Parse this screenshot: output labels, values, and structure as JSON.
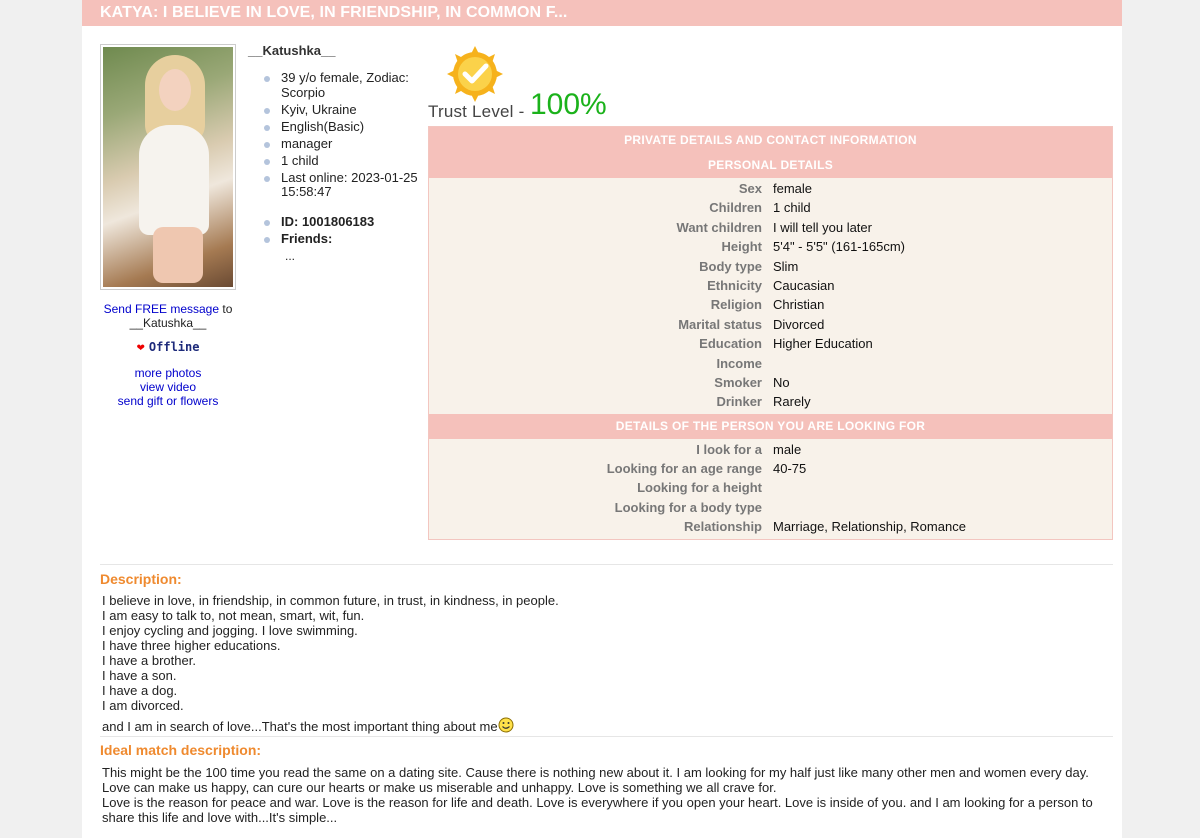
{
  "title": "KATYA: I BELIEVE IN LOVE, IN FRIENDSHIP, IN COMMON F...",
  "profile": {
    "username": "__Katushka__",
    "info": [
      "39 y/o female, Zodiac: Scorpio",
      "Kyiv, Ukraine",
      "English(Basic)",
      "manager",
      "1 child",
      "Last online: 2023-01-25 15:58:47"
    ],
    "id_label": "ID: 1001806183",
    "friends_label": "Friends:",
    "friends_more": "..."
  },
  "actions": {
    "send_free_message": "Send FREE message",
    "send_to": "to",
    "send_to_name": "__Katushka__",
    "status": "Offline",
    "more_photos": "more photos",
    "view_video": "view video",
    "send_gift": "send gift or flowers"
  },
  "trust": {
    "label": "Trust Level -",
    "value": "100%"
  },
  "details": {
    "header_private": "PRIVATE DETAILS AND CONTACT INFORMATION",
    "header_personal": "PERSONAL DETAILS",
    "personal": [
      {
        "key": "Sex",
        "value": "female"
      },
      {
        "key": "Children",
        "value": "1 child"
      },
      {
        "key": "Want children",
        "value": "I will tell you later"
      },
      {
        "key": "Height",
        "value": "5'4\" - 5'5\" (161-165cm)"
      },
      {
        "key": "Body type",
        "value": "Slim"
      },
      {
        "key": "Ethnicity",
        "value": "Caucasian"
      },
      {
        "key": "Religion",
        "value": "Christian"
      },
      {
        "key": "Marital status",
        "value": "Divorced"
      },
      {
        "key": "Education",
        "value": "Higher Education"
      },
      {
        "key": "Income",
        "value": ""
      },
      {
        "key": "Smoker",
        "value": "No"
      },
      {
        "key": "Drinker",
        "value": "Rarely"
      }
    ],
    "header_looking": "DETAILS OF THE PERSON YOU ARE LOOKING FOR",
    "looking": [
      {
        "key": "I look for a",
        "value": "male"
      },
      {
        "key": "Looking for an age range",
        "value": "40-75"
      },
      {
        "key": "Looking for a height",
        "value": ""
      },
      {
        "key": "Looking for a body type",
        "value": ""
      },
      {
        "key": "Relationship",
        "value": "Marriage, Relationship, Romance"
      }
    ]
  },
  "description": {
    "title": "Description:",
    "lines": [
      "I believe in love, in friendship, in common future, in trust, in kindness, in people.",
      "I am easy to talk to, not mean, smart, wit, fun.",
      "I enjoy cycling and jogging. I love swimming.",
      "I have three higher educations.",
      "I have a brother.",
      "I have a son.",
      "I have a dog.",
      "I am divorced."
    ],
    "last_line": "and I am in search of love...That's the most important thing about me"
  },
  "ideal": {
    "title": "Ideal match description:",
    "lines": [
      "This might be the 100 time you read the same on a dating site. Cause there is nothing new about it. I am looking for my half just like many other men and women every day.",
      "Love can make us happy, can cure our hearts or make us miserable and unhappy. Love is something we all crave for.",
      "Love is the reason for peace and war. Love is the reason for life and death. Love is everywhere if you open your heart. Love is inside of you. and I am looking for a person to share this life and love with...It's simple..."
    ]
  },
  "colors": {
    "accent": "#f5c1bb",
    "section_title": "#ef8a2f",
    "trust_value": "#1bb21b",
    "link": "#0000cc"
  }
}
